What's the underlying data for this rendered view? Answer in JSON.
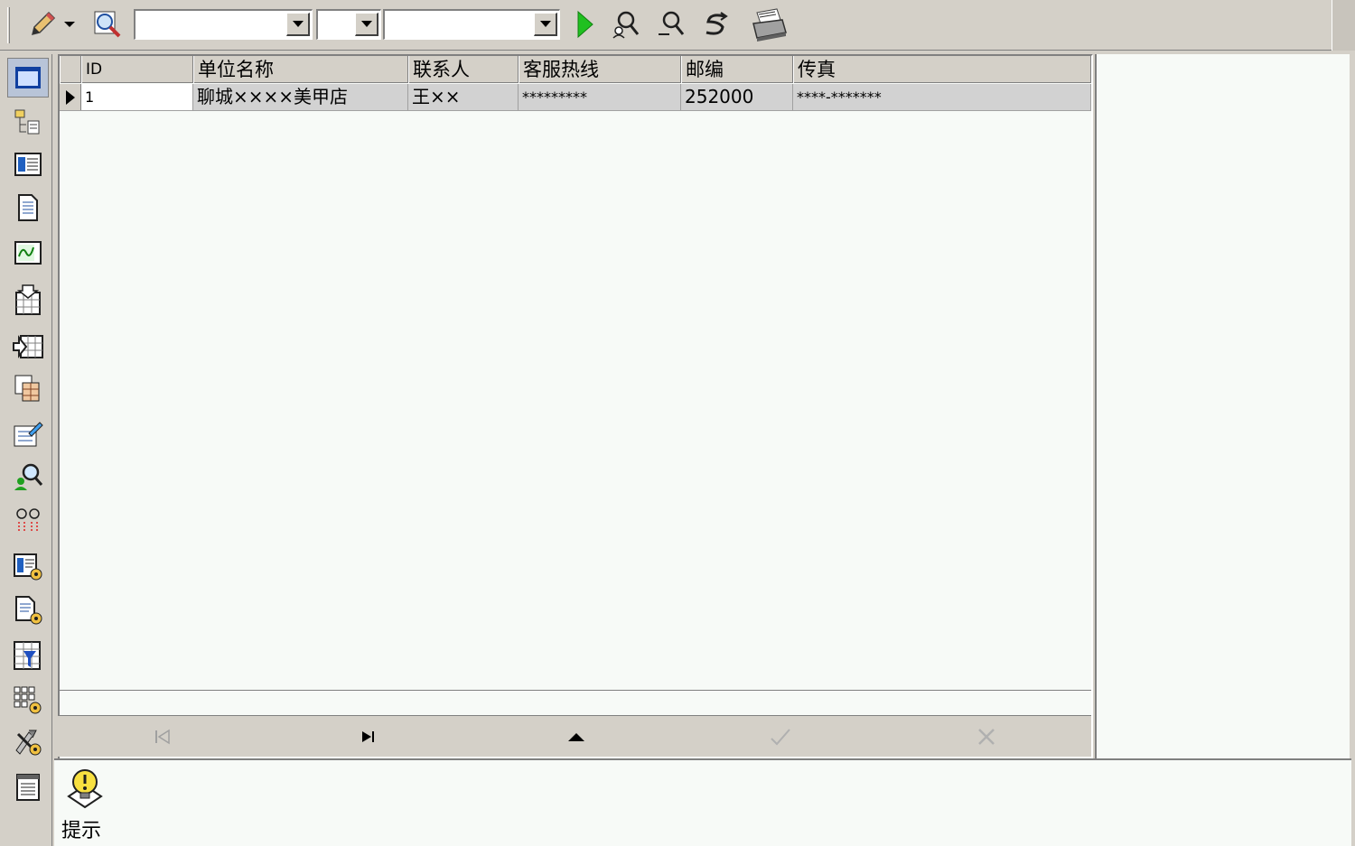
{
  "toolbar": {
    "edit_icon": "pencil-icon",
    "dropdown_icon": "chevron-down-icon",
    "search_icon": "magnifier-icon",
    "combo1_value": "",
    "combo2_value": "",
    "combo3_value": "",
    "run_icon": "play-icon",
    "find_icon": "find-person-icon",
    "find2_icon": "find-person-minus-icon",
    "refresh_icon": "refresh-icon",
    "print_icon": "printer-icon"
  },
  "sidebar": {
    "items": [
      {
        "icon": "window-icon"
      },
      {
        "icon": "tree-list-icon"
      },
      {
        "icon": "card-icon"
      },
      {
        "icon": "document-icon"
      },
      {
        "icon": "chart-icon"
      },
      {
        "icon": "table-import-icon"
      },
      {
        "icon": "table-export-icon"
      },
      {
        "icon": "copy-table-icon"
      },
      {
        "icon": "edit-form-icon"
      },
      {
        "icon": "user-search-icon"
      },
      {
        "icon": "pairs-icon"
      },
      {
        "icon": "card-settings-icon"
      },
      {
        "icon": "doc-settings-icon"
      },
      {
        "icon": "filter-table-icon"
      },
      {
        "icon": "grid-settings-icon"
      },
      {
        "icon": "tools-settings-icon"
      },
      {
        "icon": "notepad-icon"
      }
    ]
  },
  "grid": {
    "columns": [
      "ID",
      "单位名称",
      "联系人",
      "客服热线",
      "邮编",
      "传真"
    ],
    "rows": [
      [
        "1",
        "聊城××××美甲店",
        "王××",
        "*********",
        "252000",
        "****-*******"
      ]
    ]
  },
  "navigator": {
    "first_icon": "first-record-icon",
    "last_icon": "last-record-icon",
    "up_icon": "move-up-icon",
    "post_icon": "check-icon",
    "cancel_icon": "cancel-icon"
  },
  "hint": {
    "icon": "lightbulb-icon",
    "label": "提示"
  }
}
